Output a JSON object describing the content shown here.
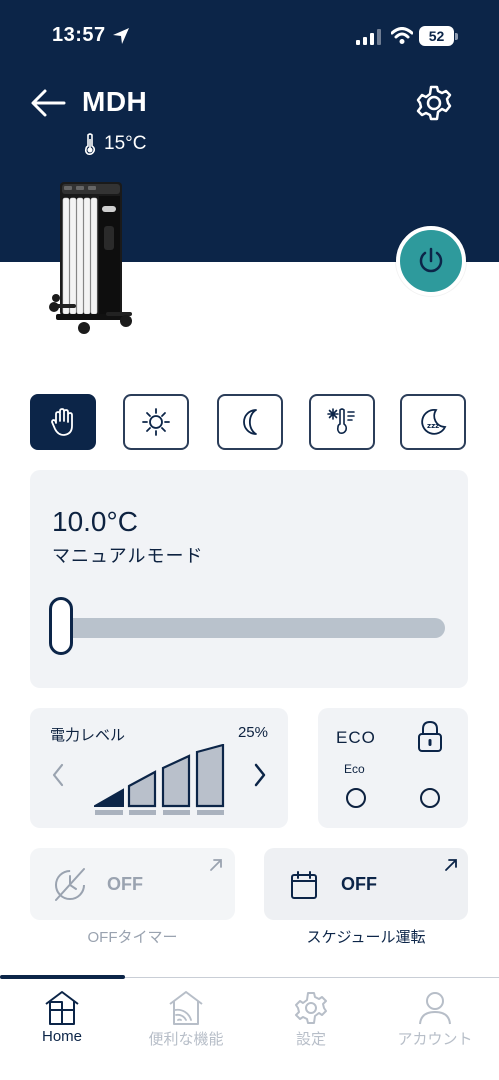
{
  "status_bar": {
    "time": "13:57",
    "battery": "52"
  },
  "header": {
    "device_name": "MDH",
    "room_temperature": "15°C"
  },
  "colors": {
    "navy": "#0c2548",
    "teal": "#2e9a9c",
    "card_bg": "#f1f3f6",
    "muted": "#9aa3b0"
  },
  "modes": [
    {
      "id": "manual",
      "icon": "hand-icon",
      "active": true
    },
    {
      "id": "comfort",
      "icon": "sun-icon",
      "active": false
    },
    {
      "id": "night",
      "icon": "moon-icon",
      "active": false
    },
    {
      "id": "antifreeze",
      "icon": "snowflake-thermometer-icon",
      "active": false
    },
    {
      "id": "sleep",
      "icon": "sleep-zzz-icon",
      "active": false
    }
  ],
  "temperature_card": {
    "target_temperature": "10.0°C",
    "mode_label": "マニュアルモード",
    "slider_level": 0.0
  },
  "power_card": {
    "title": "電力レベル",
    "percent": "25%",
    "level_steps": 4,
    "active_steps": 1
  },
  "eco_card": {
    "title": "ECO",
    "eco_label": "Eco",
    "eco_selected": false,
    "lock_selected": false
  },
  "off_timer": {
    "value": "OFF",
    "caption": "OFFタイマー",
    "enabled": false
  },
  "schedule": {
    "value": "OFF",
    "caption": "スケジュール運転",
    "enabled": true
  },
  "tabs": [
    {
      "label": "Home",
      "icon": "home-icon",
      "active": true
    },
    {
      "label": "便利な機能",
      "icon": "smart-home-icon",
      "active": false
    },
    {
      "label": "設定",
      "icon": "gear-icon",
      "active": false
    },
    {
      "label": "アカウント",
      "icon": "person-icon",
      "active": false
    }
  ]
}
